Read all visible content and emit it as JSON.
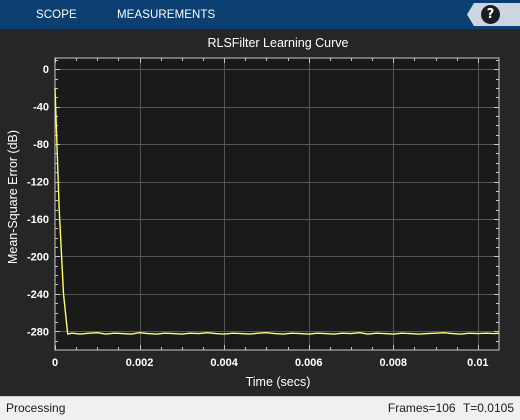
{
  "toolstrip": {
    "tabs": [
      {
        "label": "SCOPE"
      },
      {
        "label": "MEASUREMENTS"
      }
    ],
    "help_label": "?"
  },
  "chart_data": {
    "type": "line",
    "title": "RLSFilter Learning Curve",
    "xlabel": "Time (secs)",
    "ylabel": "Mean-Square Error (dB)",
    "xlim": [
      0,
      0.0105
    ],
    "ylim": [
      -300,
      12
    ],
    "xticks": [
      0,
      0.002,
      0.004,
      0.006,
      0.008,
      0.01
    ],
    "xtick_labels": [
      "0",
      "0.002",
      "0.004",
      "0.006",
      "0.008",
      "0.01"
    ],
    "yticks": [
      0,
      -40,
      -80,
      -120,
      -160,
      -200,
      -240,
      -280
    ],
    "ytick_labels": [
      "0",
      "-40",
      "-80",
      "-120",
      "-160",
      "-200",
      "-240",
      "-280"
    ],
    "grid": true,
    "background": "#1a1a1a",
    "line_color": "#ffff66",
    "series": [
      {
        "x": [
          0,
          0.0001,
          0.0002,
          0.0003,
          0.0004,
          0.0006,
          0.0008,
          0.001,
          0.0012,
          0.0014,
          0.0016,
          0.0018,
          0.002,
          0.0022,
          0.0024,
          0.0026,
          0.0028,
          0.003,
          0.0032,
          0.0034,
          0.0036,
          0.0038,
          0.004,
          0.0042,
          0.0044,
          0.0046,
          0.0048,
          0.005,
          0.0052,
          0.0054,
          0.0056,
          0.0058,
          0.006,
          0.0062,
          0.0064,
          0.0066,
          0.0068,
          0.007,
          0.0072,
          0.0074,
          0.0076,
          0.0078,
          0.008,
          0.0082,
          0.0084,
          0.0086,
          0.0088,
          0.009,
          0.0092,
          0.0094,
          0.0096,
          0.0098,
          0.01,
          0.0102,
          0.0104,
          0.0105
        ],
        "y": [
          -20,
          -150,
          -240,
          -283,
          -282,
          -283,
          -282,
          -281.5,
          -283,
          -282,
          -282.5,
          -283,
          -281.5,
          -282.5,
          -283,
          -282,
          -282.5,
          -283,
          -282,
          -282.5,
          -281.5,
          -282.5,
          -283,
          -282,
          -282.5,
          -283,
          -282,
          -281.5,
          -282.5,
          -283,
          -282,
          -282.5,
          -283,
          -282,
          -282.5,
          -283,
          -282,
          -282.5,
          -281.5,
          -283,
          -282,
          -282.5,
          -283,
          -282,
          -282.5,
          -283,
          -282.5,
          -282,
          -281.5,
          -282.5,
          -283,
          -282,
          -282.5,
          -282,
          -282.5,
          -282
        ]
      }
    ]
  },
  "status": {
    "state": "Processing",
    "frames": "Frames=106",
    "time": "T=0.0105"
  }
}
